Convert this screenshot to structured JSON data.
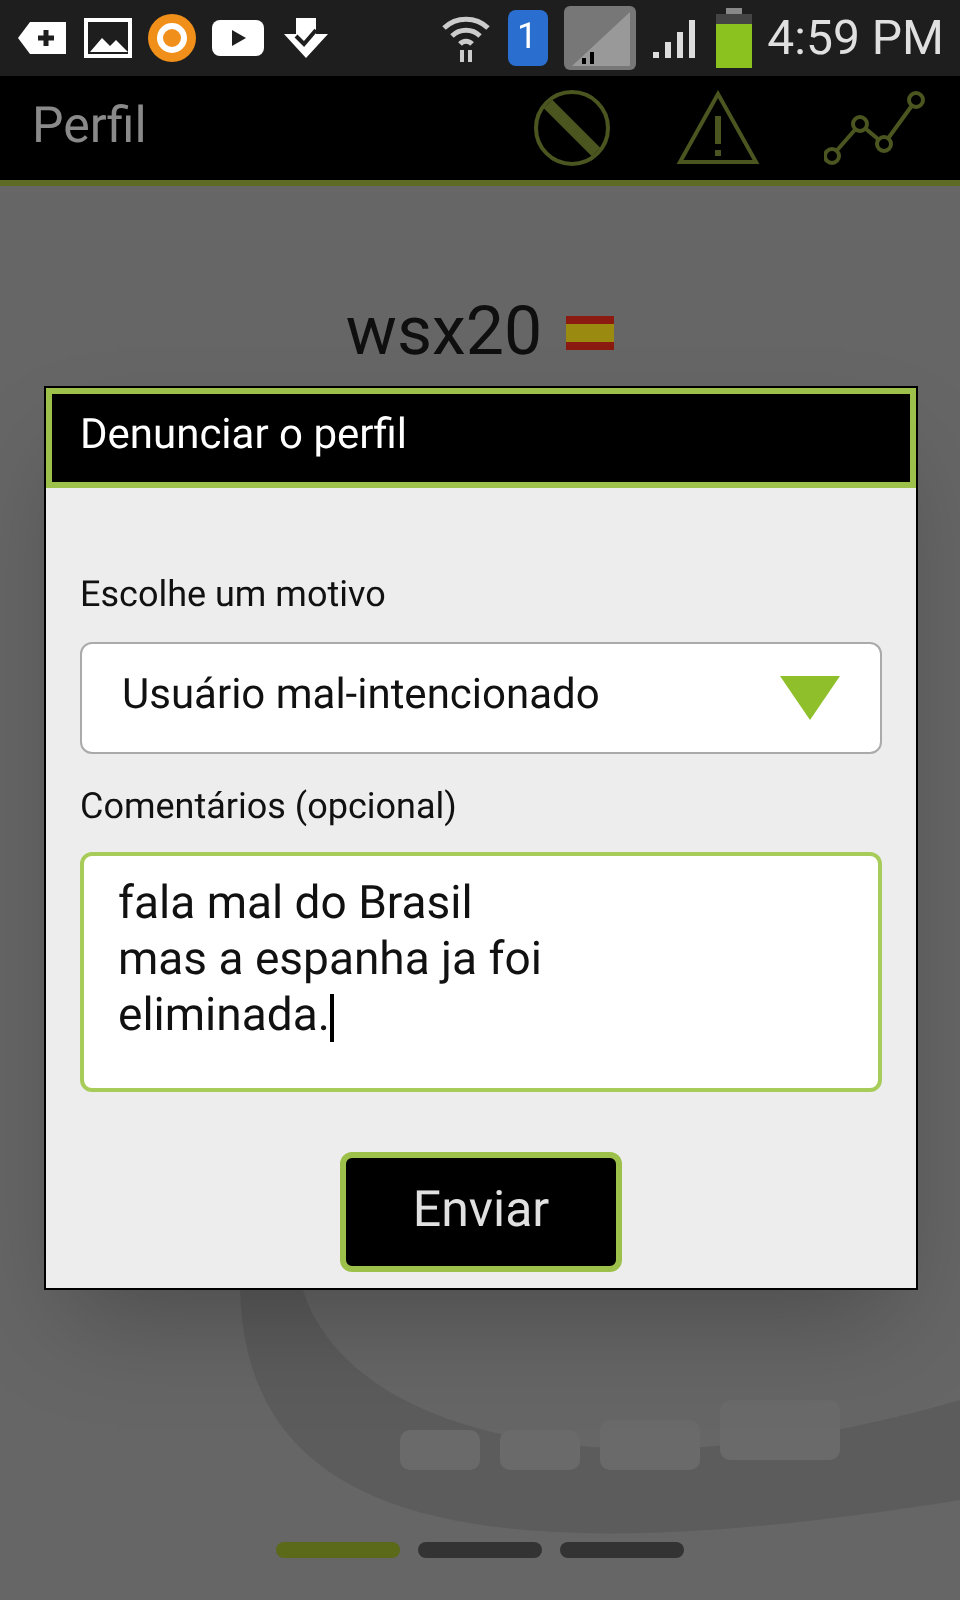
{
  "status_bar": {
    "sim_label": "1",
    "time": "4:59 PM"
  },
  "app_bar": {
    "title": "Perfil"
  },
  "profile": {
    "name": "wsx20"
  },
  "dialog": {
    "title": "Denunciar o perfil",
    "reason_label": "Escolhe um motivo",
    "reason_value": "Usuário mal-intencionado",
    "comments_label": "Comentários (opcional)",
    "comments_value": "fala mal do Brasil\nmas a espanha ja foi\neliminada.",
    "submit": "Enviar"
  },
  "pager": [
    {
      "selected": true
    },
    {
      "selected": false
    },
    {
      "selected": false
    }
  ]
}
